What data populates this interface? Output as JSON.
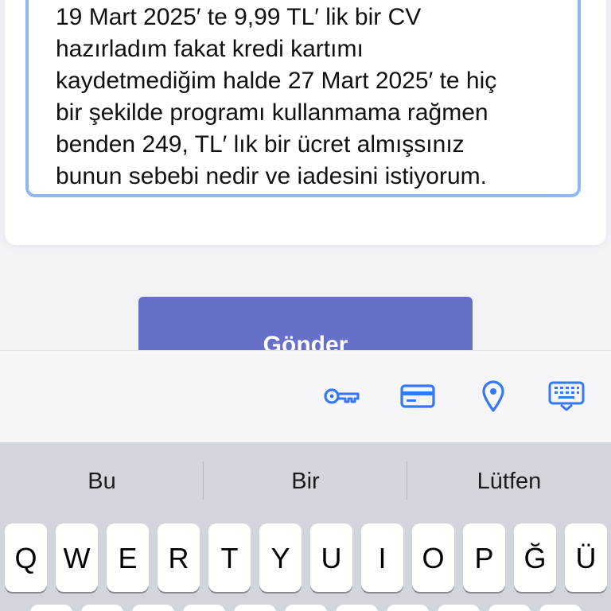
{
  "form": {
    "message_text": "19 Mart 2025′ te 9,99 TL′ lik bir CV\nhazırladım fakat kredi kartımı\nkaydetmediğim halde 27 Mart 2025′ te hiç\nbir şekilde programı kullanmama rağmen\nbenden 249, TL′ lık bir ücret almışsınız\nbunun sebebi nedir ve iadesini istiyorum.",
    "send_label": "Gönder"
  },
  "accessory_bar": {
    "icons": [
      "key-icon",
      "credit-card-icon",
      "location-pin-icon",
      "keyboard-dismiss-icon"
    ]
  },
  "keyboard": {
    "suggestions": [
      "Bu",
      "Bir",
      "Lütfen"
    ],
    "row1": [
      "Q",
      "W",
      "E",
      "R",
      "T",
      "Y",
      "U",
      "I",
      "O",
      "P",
      "Ğ",
      "Ü"
    ]
  },
  "colors": {
    "accent": "#3478f6",
    "button": "#6670c8",
    "focus_border": "#8fb7f2",
    "keyboard_bg": "#d2d5db"
  }
}
